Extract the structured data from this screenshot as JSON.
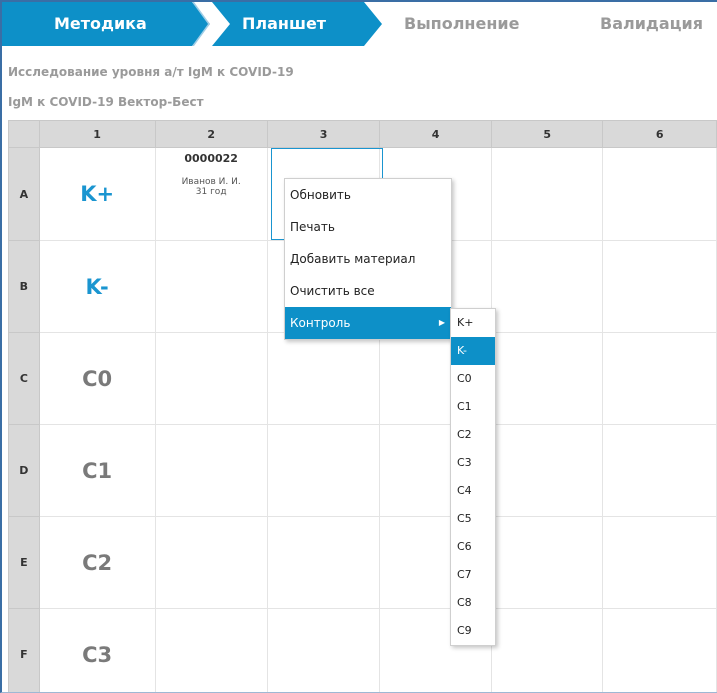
{
  "wizard": {
    "steps": [
      {
        "label": "Методика",
        "state": "done"
      },
      {
        "label": "Планшет",
        "state": "active"
      },
      {
        "label": "Выполнение",
        "state": "pending"
      },
      {
        "label": "Валидация",
        "state": "pending"
      }
    ],
    "active_color": "#0d90c8"
  },
  "study": {
    "title": "Исследование уровня а/т IgM к COVID-19",
    "kit": "IgM к COVID-19 Вектор-Бест"
  },
  "plate": {
    "columns": [
      "1",
      "2",
      "3",
      "4",
      "5",
      "6"
    ],
    "rows": [
      {
        "label": "A",
        "control": "K+",
        "style": "blue",
        "sample": {
          "code": "0000022",
          "name": "Иванов И. И.",
          "age": "31 год"
        }
      },
      {
        "label": "B",
        "control": "K-",
        "style": "blue"
      },
      {
        "label": "C",
        "control": "C0",
        "style": "grey"
      },
      {
        "label": "D",
        "control": "C1",
        "style": "grey"
      },
      {
        "label": "E",
        "control": "C2",
        "style": "grey"
      },
      {
        "label": "F",
        "control": "C3",
        "style": "grey"
      }
    ]
  },
  "context_menu": {
    "items": [
      "Обновить",
      "Печать",
      "Добавить материал",
      "Очистить все",
      "Контроль"
    ],
    "highlighted": "Контроль",
    "submenu": {
      "items": [
        "K+",
        "K-",
        "C0",
        "C1",
        "C2",
        "C3",
        "C4",
        "C5",
        "C6",
        "C7",
        "C8",
        "C9"
      ],
      "highlighted": "K-"
    }
  }
}
